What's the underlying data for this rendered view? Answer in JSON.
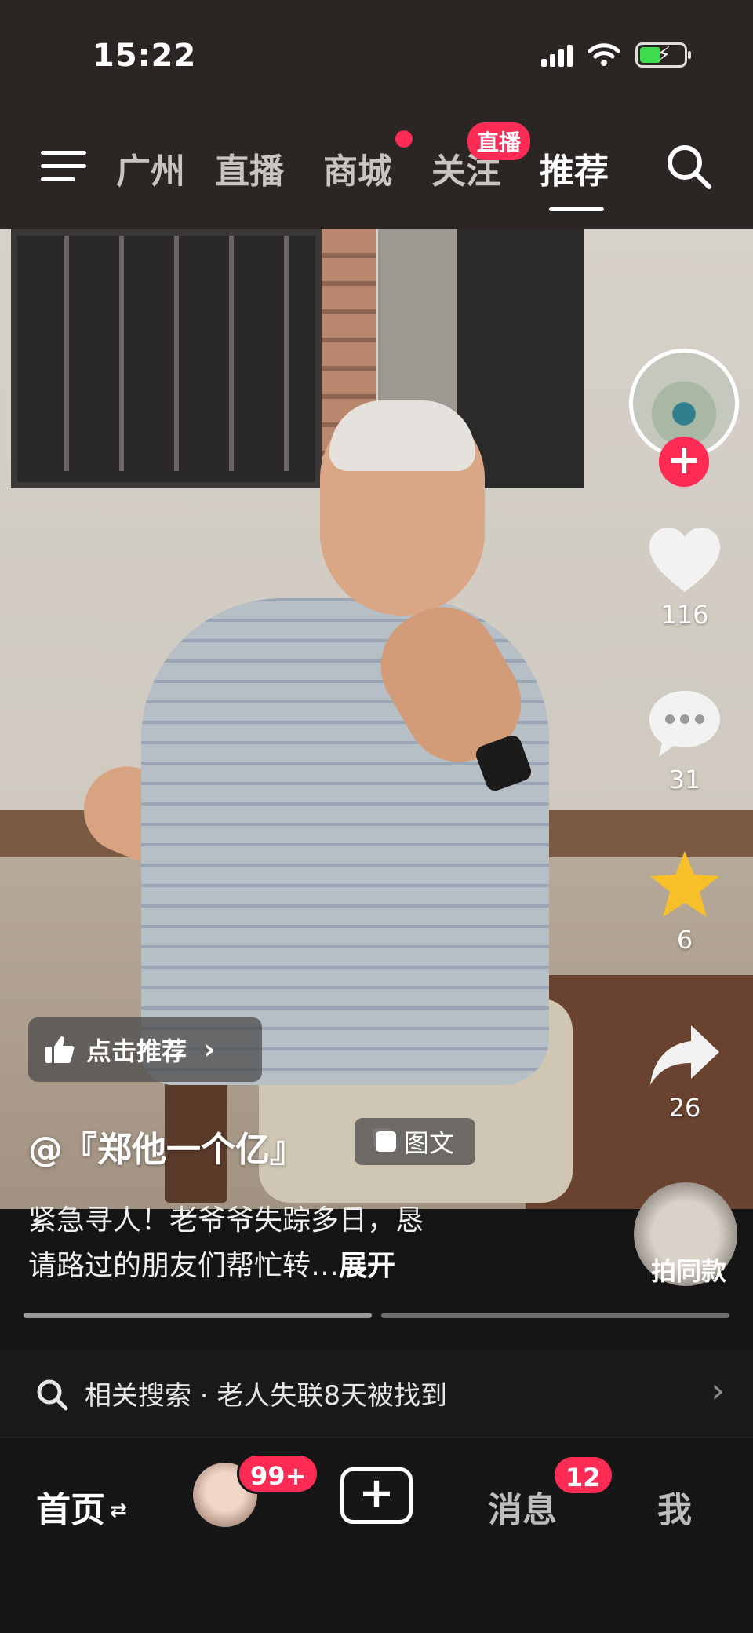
{
  "status_bar": {
    "time": "15:22"
  },
  "top_nav": {
    "tabs": [
      {
        "label": "广州"
      },
      {
        "label": "直播"
      },
      {
        "label": "商城"
      },
      {
        "label": "关注"
      },
      {
        "label": "推荐"
      }
    ],
    "active_tab": "推荐",
    "live_badge": "直播"
  },
  "actions": {
    "likes": "116",
    "comments": "31",
    "favorites": "6",
    "shares": "26"
  },
  "recommend_chip": "点击推荐",
  "author": "@『郑他一个亿』",
  "post_type": "图文",
  "caption": {
    "line1": "紧急寻人！老爷爷失踪多日，恳",
    "line2": "请路过的朋友们帮忙转…",
    "expand": "展开"
  },
  "music_label": "拍同款",
  "related_search": {
    "text": "相关搜索 · 老人失联8天被找到"
  },
  "bottom_tabs": {
    "home": "首页",
    "friends_badge": "99+",
    "messages": "消息",
    "messages_badge": "12",
    "me": "我"
  },
  "colors": {
    "accent": "#fe2c55",
    "favorite": "#f7c02a"
  }
}
